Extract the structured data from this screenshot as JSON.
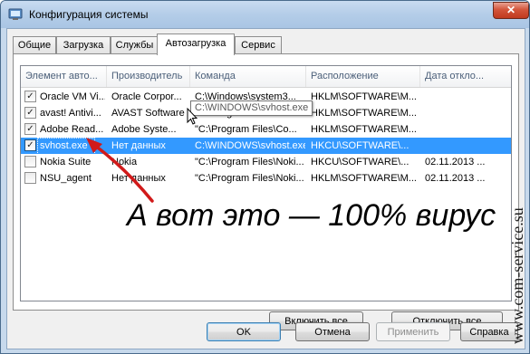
{
  "window": {
    "title": "Конфигурация системы",
    "close_label": "✕"
  },
  "tabs": [
    {
      "label": "Общие"
    },
    {
      "label": "Загрузка"
    },
    {
      "label": "Службы"
    },
    {
      "label": "Автозагрузка",
      "active": true
    },
    {
      "label": "Сервис"
    }
  ],
  "table": {
    "columns": [
      "Элемент авто...",
      "Производитель",
      "Команда",
      "Расположение",
      "Дата откло..."
    ],
    "rows": [
      {
        "checked": true,
        "name": "Oracle VM Vi...",
        "vendor": "Oracle Corpor...",
        "command": "C:\\Windows\\system3...",
        "location": "HKLM\\SOFTWARE\\M...",
        "date": ""
      },
      {
        "checked": true,
        "name": "avast! Antivi...",
        "vendor": "AVAST Software",
        "command": "\"C:\\Program Files\\AVA...",
        "location": "HKLM\\SOFTWARE\\M...",
        "date": ""
      },
      {
        "checked": true,
        "name": "Adobe Read...",
        "vendor": "Adobe Syste...",
        "command": "\"C:\\Program Files\\Co...",
        "location": "HKLM\\SOFTWARE\\M...",
        "date": ""
      },
      {
        "checked": true,
        "name": "svhost.exe",
        "vendor": "Нет данных",
        "command": "C:\\WINDOWS\\svhost.exe",
        "location": "HKCU\\SOFTWARE\\...",
        "date": "",
        "selected": true
      },
      {
        "checked": false,
        "name": "Nokia Suite",
        "vendor": "Nokia",
        "command": "\"C:\\Program Files\\Noki...",
        "location": "HKCU\\SOFTWARE\\...",
        "date": "02.11.2013 ..."
      },
      {
        "checked": false,
        "name": "NSU_agent",
        "vendor": "Нет данных",
        "command": "\"C:\\Program Files\\Noki...",
        "location": "HKLM\\SOFTWARE\\M...",
        "date": "02.11.2013 ..."
      }
    ]
  },
  "tooltip_text": "C:\\WINDOWS\\svhost.exe",
  "buttons": {
    "enable_all": "Включить все",
    "disable_all": "Отключить все",
    "ok": "OK",
    "cancel": "Отмена",
    "apply": "Применить",
    "help": "Справка"
  },
  "annotation_text": "А вот это — 100% вирус",
  "watermark_text": "www.com-service.su",
  "colors": {
    "selection": "#3399ff",
    "arrow": "#d11a1a"
  }
}
